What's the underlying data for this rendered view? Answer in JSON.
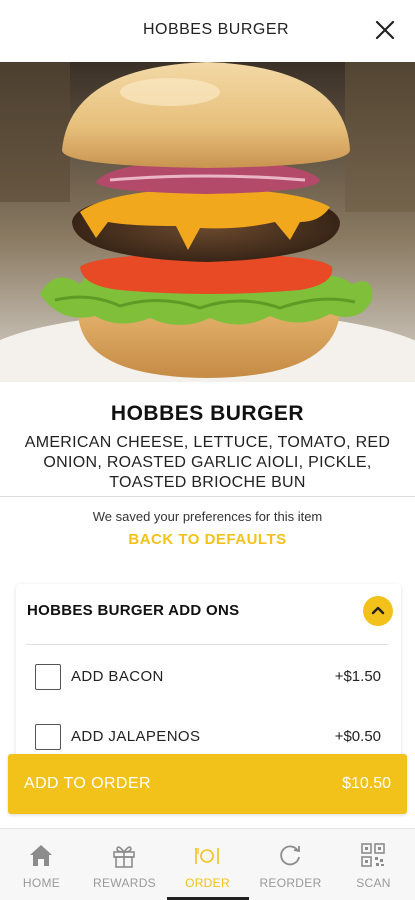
{
  "header": {
    "title": "HOBBES BURGER",
    "close_icon": "close-icon"
  },
  "item": {
    "title": "HOBBES BURGER",
    "description": "AMERICAN CHEESE, LETTUCE, TOMATO, RED ONION, ROASTED GARLIC AIOLI, PICKLE, TOASTED BRIOCHE BUN"
  },
  "preferences": {
    "note": "We saved your preferences for this item",
    "reset_label": "BACK TO DEFAULTS"
  },
  "addons": {
    "title": "HOBBES BURGER ADD ONS",
    "items": [
      {
        "label": "ADD BACON",
        "price": "+$1.50",
        "checked": false
      },
      {
        "label": "ADD JALAPENOS",
        "price": "+$0.50",
        "checked": false
      }
    ]
  },
  "cta": {
    "label": "ADD TO ORDER",
    "price": "$10.50"
  },
  "tabs": [
    {
      "label": "HOME",
      "icon": "home-icon",
      "active": false
    },
    {
      "label": "REWARDS",
      "icon": "gift-icon",
      "active": false
    },
    {
      "label": "ORDER",
      "icon": "plate-icon",
      "active": true
    },
    {
      "label": "REORDER",
      "icon": "refresh-icon",
      "active": false
    },
    {
      "label": "SCAN",
      "icon": "qr-code-icon",
      "active": false
    }
  ],
  "colors": {
    "accent": "#f2c21b",
    "text": "#1a1a1a",
    "inactive_tab": "#9a9a9a"
  }
}
